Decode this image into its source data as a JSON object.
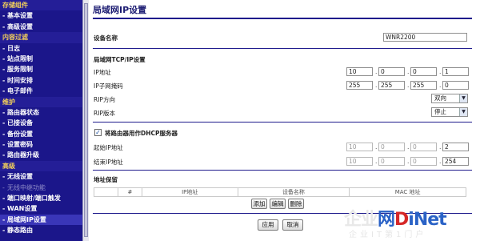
{
  "sidebar": {
    "sections": [
      {
        "title": "存储组件",
        "items": [
          {
            "label": "基本设置",
            "enabled": true
          },
          {
            "label": "高级设置",
            "enabled": true
          }
        ]
      },
      {
        "title": "内容过滤",
        "items": [
          {
            "label": "日志",
            "enabled": true
          },
          {
            "label": "站点限制",
            "enabled": true
          },
          {
            "label": "服务限制",
            "enabled": true
          },
          {
            "label": "时间安排",
            "enabled": true
          },
          {
            "label": "电子邮件",
            "enabled": true
          }
        ]
      },
      {
        "title": "维护",
        "items": [
          {
            "label": "路由器状态",
            "enabled": true
          },
          {
            "label": "已接设备",
            "enabled": true
          },
          {
            "label": "备份设置",
            "enabled": true
          },
          {
            "label": "设置密码",
            "enabled": true
          },
          {
            "label": "路由器升级",
            "enabled": true
          }
        ]
      },
      {
        "title": "高级",
        "items": [
          {
            "label": "无线设置",
            "enabled": true
          },
          {
            "label": "无线中继功能",
            "enabled": false
          },
          {
            "label": "端口映射/端口触发",
            "enabled": true
          },
          {
            "label": "WAN设置",
            "enabled": true
          },
          {
            "label": "局域网IP设置",
            "enabled": true,
            "active": true
          },
          {
            "label": "静态路由",
            "enabled": true
          }
        ]
      }
    ]
  },
  "page": {
    "title": "局域网IP设置",
    "device_name_label": "设备名称",
    "device_name_value": "WNR2200",
    "tcpip_section": "局域网TCP/IP设置",
    "ip_label": "IP地址",
    "ip": [
      "10",
      "0",
      "0",
      "1"
    ],
    "mask_label": "IP子网掩码",
    "mask": [
      "255",
      "255",
      "255",
      "0"
    ],
    "rip_dir_label": "RIP方向",
    "rip_dir_value": "双向",
    "rip_ver_label": "RIP版本",
    "rip_ver_value": "停止",
    "dhcp_checkbox_label": "将路由器用作DHCP服务器",
    "dhcp_checked": true,
    "start_ip_label": "起始IP地址",
    "start_ip": [
      "10",
      "0",
      "0",
      "2"
    ],
    "end_ip_label": "结束IP地址",
    "end_ip": [
      "10",
      "0",
      "0",
      "254"
    ],
    "reservation_label": "地址保留",
    "table_headers": [
      "",
      "#",
      "IP地址",
      "设备名称",
      "MAC 地址"
    ],
    "add_button": "添加",
    "edit_button": "编辑",
    "delete_button": "删除",
    "apply_button": "应用",
    "cancel_button": "取消"
  },
  "watermark": {
    "brand_a": "企业",
    "brand_b": "网",
    "brand_c": "D",
    "brand_d": "iNet",
    "sub": "企业IT第1门户"
  },
  "colors": {
    "sidebar_bg": "#1b168a",
    "section_title": "#f4d15a",
    "rule": "#1e1a8c"
  }
}
